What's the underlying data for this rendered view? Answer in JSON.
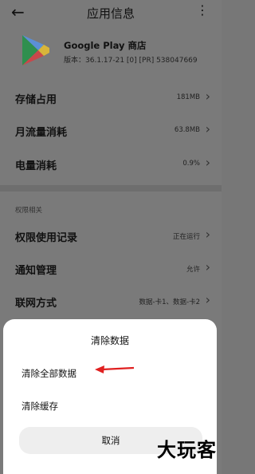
{
  "header": {
    "title": "应用信息",
    "back_icon": "back-arrow-icon",
    "more_icon": "more-vertical-icon"
  },
  "app": {
    "name": "Google Play 商店",
    "version": "版本：36.1.17-21 [0] [PR] 538047669",
    "icon": "google-play-logo"
  },
  "rows": [
    {
      "label": "存储占用",
      "value": "181MB"
    },
    {
      "label": "月流量消耗",
      "value": "63.8MB"
    },
    {
      "label": "电量消耗",
      "value": "0.9%"
    }
  ],
  "permissions": {
    "section_label": "权限相关",
    "rows": [
      {
        "label": "权限使用记录",
        "value": "正在运行"
      },
      {
        "label": "通知管理",
        "value": "允许"
      },
      {
        "label": "联网方式",
        "value": "数据-卡1、数据-卡2"
      }
    ]
  },
  "dialog": {
    "title": "清除数据",
    "option_all": "清除全部数据",
    "option_cache": "清除缓存",
    "cancel": "取消"
  },
  "annotation": {
    "arrow_color": "#e02020"
  },
  "watermark": "大玩客"
}
